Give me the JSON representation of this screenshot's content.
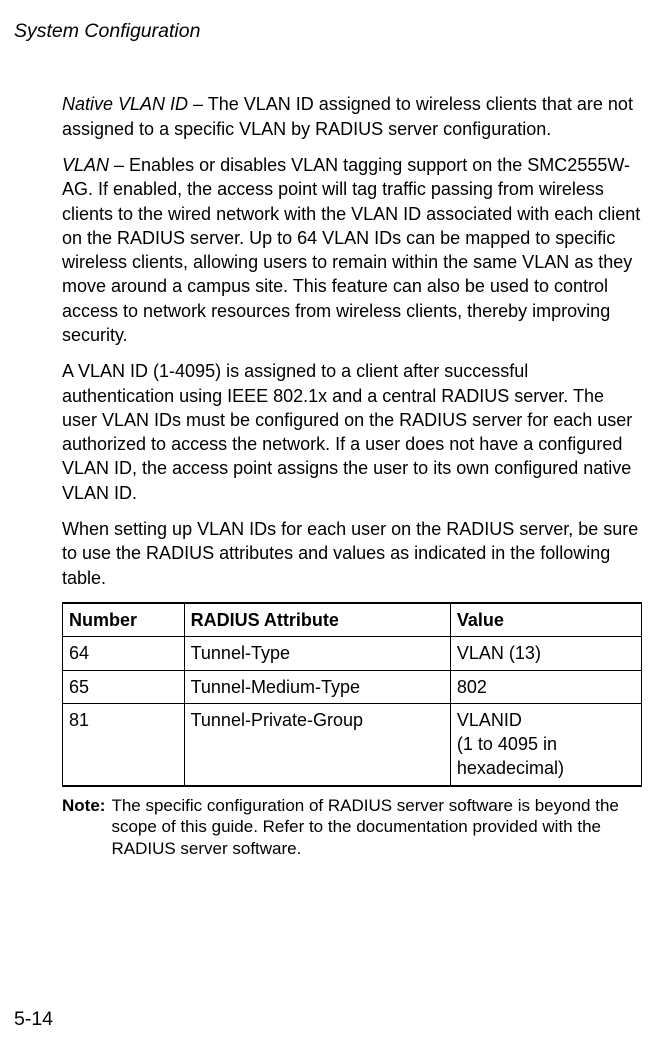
{
  "header": "System Configuration",
  "para1": {
    "term": "Native VLAN ID",
    "text": " – The VLAN ID assigned to wireless clients that are not assigned to a specific VLAN by RADIUS server configuration."
  },
  "para2": {
    "term": "VLAN",
    "text": " – Enables or disables VLAN tagging support on the SMC2555W-AG. If enabled, the access point will tag traffic passing from wireless clients to the wired network with the VLAN ID associated with each client on the RADIUS server. Up to 64 VLAN IDs can be mapped to specific wireless clients, allowing users to remain within the same VLAN as they move around a campus site. This feature can also be used to control access to network resources from wireless clients, thereby improving security."
  },
  "para3": "A VLAN ID (1-4095) is assigned to a client after successful authentication using IEEE 802.1x and a central RADIUS server. The user VLAN IDs must be configured on the RADIUS server for each user authorized to access the network. If a user does not have a configured VLAN ID, the access point assigns the user to its own configured native VLAN ID.",
  "para4": "When setting up VLAN IDs for each user on the RADIUS server, be sure to use the RADIUS attributes and values as indicated in the following table.",
  "table": {
    "headers": {
      "c0": "Number",
      "c1": "RADIUS Attribute",
      "c2": "Value"
    },
    "rows": [
      {
        "c0": "64",
        "c1": "Tunnel-Type",
        "c2": "VLAN (13)"
      },
      {
        "c0": "65",
        "c1": "Tunnel-Medium-Type",
        "c2": "802"
      },
      {
        "c0": "81",
        "c1": "Tunnel-Private-Group",
        "c2": "VLANID\n(1 to 4095 in hexadecimal)"
      }
    ]
  },
  "note": {
    "label": "Note:",
    "text": "The specific configuration of RADIUS server software is beyond the scope of this guide. Refer to the documentation provided with the RADIUS server software."
  },
  "pageNumber": "5-14"
}
